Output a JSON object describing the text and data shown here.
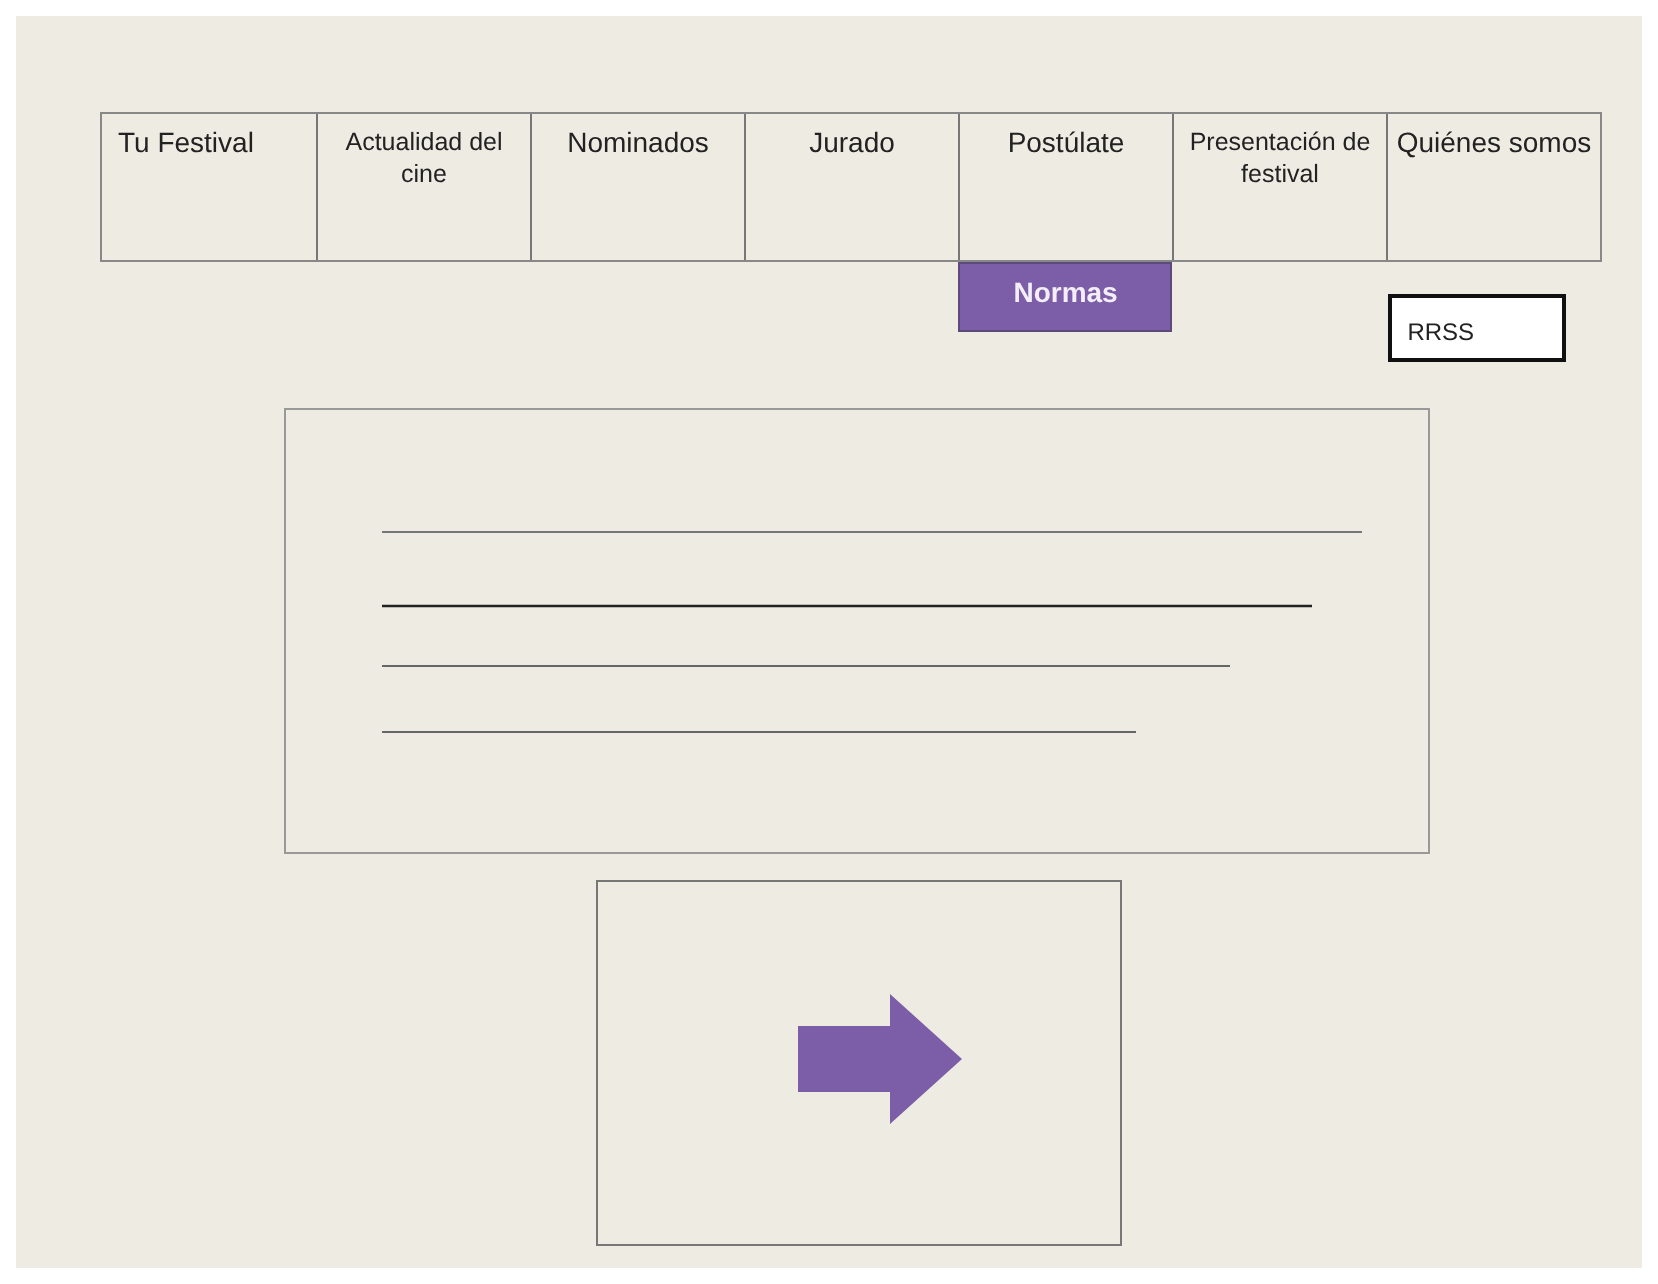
{
  "nav": [
    {
      "label": "Tu Festival"
    },
    {
      "label": "Actualidad del cine"
    },
    {
      "label": "Nominados"
    },
    {
      "label": "Jurado"
    },
    {
      "label": "Postúlate",
      "submenu": [
        {
          "label": "Normas"
        }
      ]
    },
    {
      "label": "Presentación de festival"
    },
    {
      "label": "Quiénes somos"
    }
  ],
  "social_button": {
    "label": "RRSS"
  }
}
